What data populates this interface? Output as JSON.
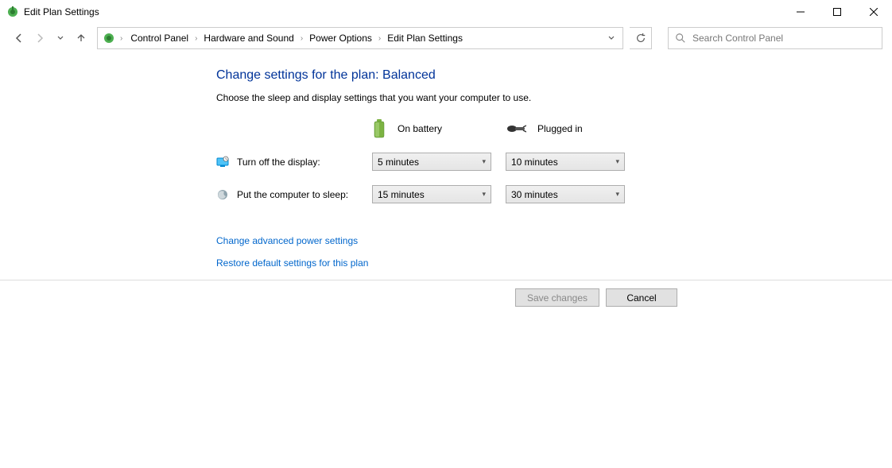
{
  "window": {
    "title": "Edit Plan Settings"
  },
  "breadcrumb": {
    "items": [
      "Control Panel",
      "Hardware and Sound",
      "Power Options",
      "Edit Plan Settings"
    ]
  },
  "search": {
    "placeholder": "Search Control Panel"
  },
  "main": {
    "heading": "Change settings for the plan: Balanced",
    "subheading": "Choose the sleep and display settings that you want your computer to use.",
    "columns": {
      "battery": "On battery",
      "plugged": "Plugged in"
    },
    "rows": {
      "display": {
        "label": "Turn off the display:",
        "battery": "5 minutes",
        "plugged": "10 minutes"
      },
      "sleep": {
        "label": "Put the computer to sleep:",
        "battery": "15 minutes",
        "plugged": "30 minutes"
      }
    },
    "links": {
      "advanced": "Change advanced power settings",
      "restore": "Restore default settings for this plan"
    }
  },
  "footer": {
    "save": "Save changes",
    "cancel": "Cancel"
  }
}
